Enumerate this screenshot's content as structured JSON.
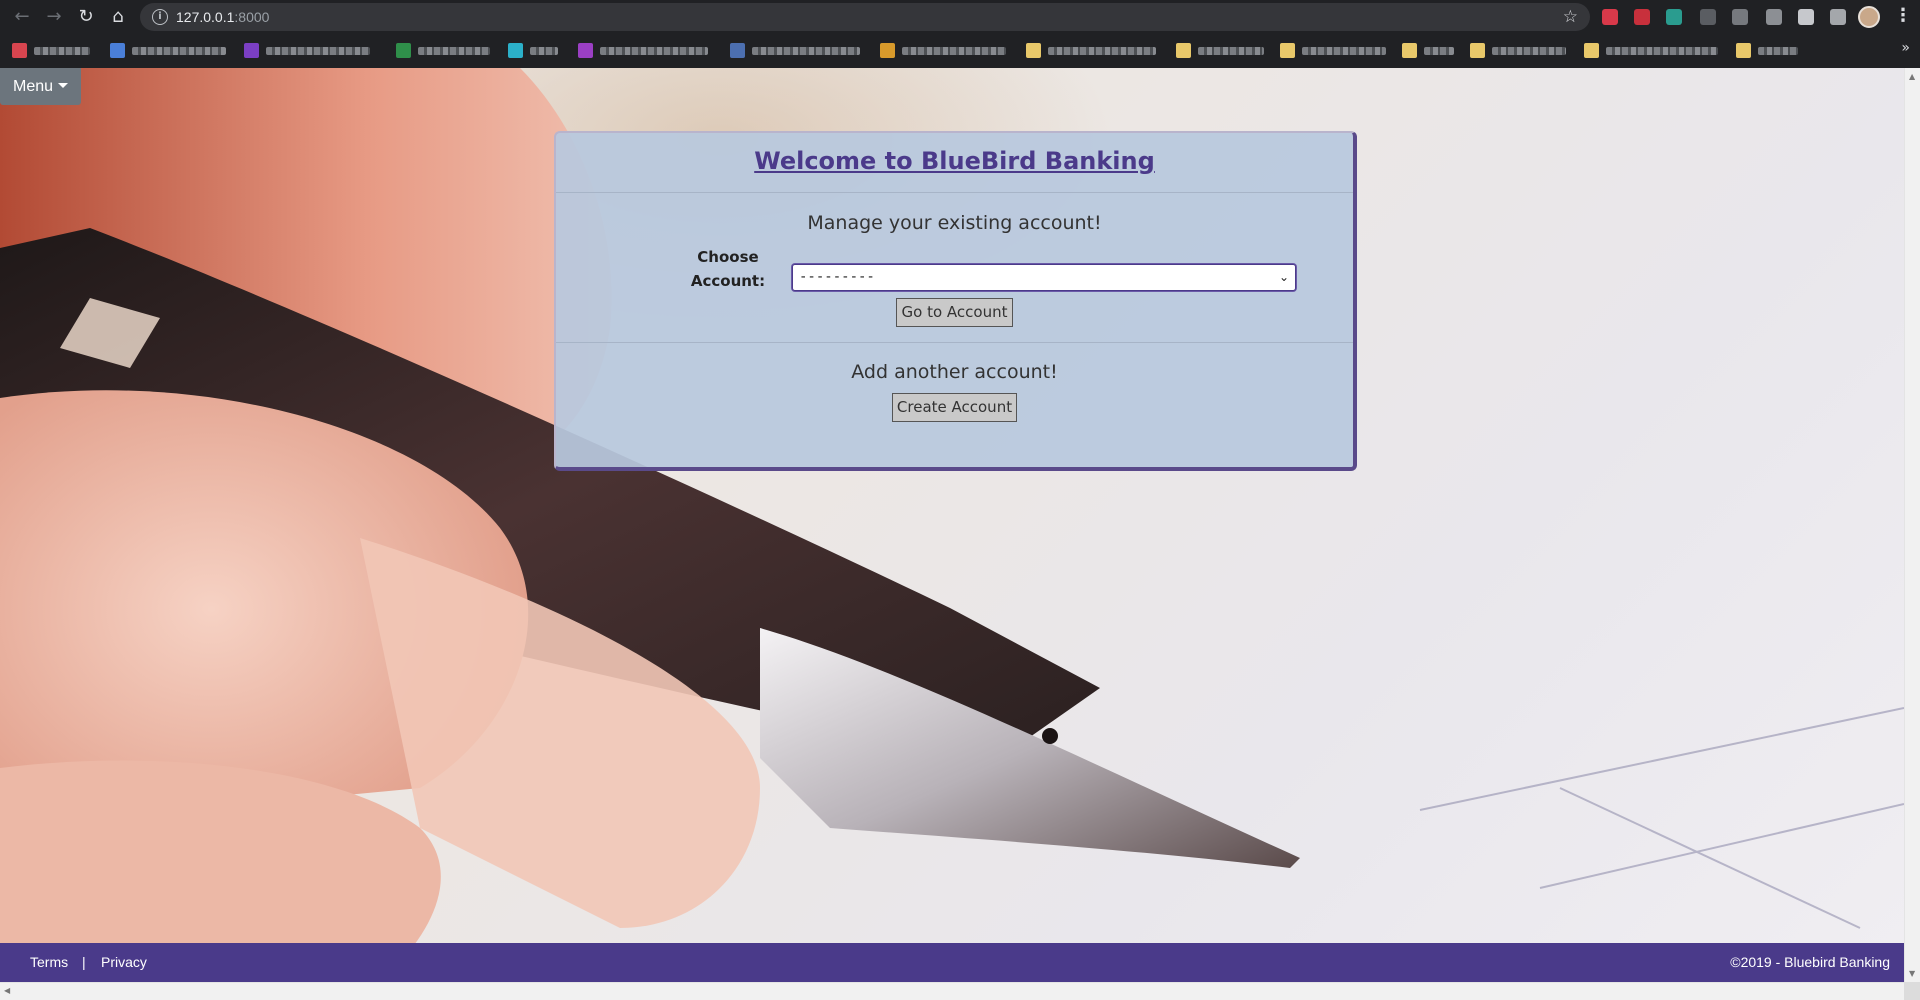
{
  "browser": {
    "url_host": "127.0.0.1",
    "url_port": ":8000",
    "back_icon": "arrow-left-icon",
    "forward_icon": "arrow-right-icon",
    "reload_icon": "reload-icon",
    "home_icon": "home-icon",
    "bookmark_icon": "star-icon"
  },
  "page": {
    "menu_label": "Menu",
    "card": {
      "title": "Welcome to BlueBird Banking",
      "manage_heading": "Manage your existing account!",
      "choose_label": "Choose Account:",
      "select_value": "---------",
      "go_button": "Go to Account",
      "add_heading": "Add another account!",
      "create_button": "Create Account"
    }
  },
  "footer": {
    "terms": "Terms",
    "separator": "|",
    "privacy": "Privacy",
    "copyright": "©2019 - Bluebird Banking"
  },
  "colors": {
    "brand": "#4a3a8a",
    "card_bg": "#b8c8de",
    "menu_button": "#6c757d"
  }
}
